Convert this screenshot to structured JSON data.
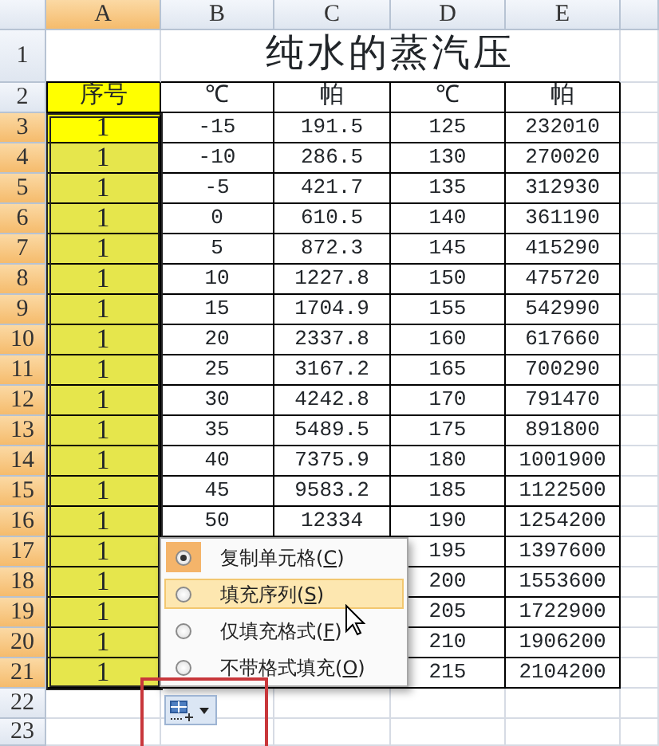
{
  "columns": [
    {
      "label": "A",
      "selected": true
    },
    {
      "label": "B",
      "selected": false
    },
    {
      "label": "C",
      "selected": false
    },
    {
      "label": "D",
      "selected": false
    },
    {
      "label": "E",
      "selected": false
    }
  ],
  "title": "纯水的蒸汽压",
  "header_row": {
    "number": "2",
    "cells": [
      "序号",
      "℃",
      "帕",
      "℃",
      "帕"
    ]
  },
  "title_row_number": "1",
  "rows": [
    {
      "number": "3",
      "selected": true,
      "active": true,
      "cells": [
        "1",
        "-15",
        "191.5",
        "125",
        "232010"
      ]
    },
    {
      "number": "4",
      "selected": true,
      "active": false,
      "cells": [
        "1",
        "-10",
        "286.5",
        "130",
        "270020"
      ]
    },
    {
      "number": "5",
      "selected": true,
      "active": false,
      "cells": [
        "1",
        "-5",
        "421.7",
        "135",
        "312930"
      ]
    },
    {
      "number": "6",
      "selected": true,
      "active": false,
      "cells": [
        "1",
        "0",
        "610.5",
        "140",
        "361190"
      ]
    },
    {
      "number": "7",
      "selected": true,
      "active": false,
      "cells": [
        "1",
        "5",
        "872.3",
        "145",
        "415290"
      ]
    },
    {
      "number": "8",
      "selected": true,
      "active": false,
      "cells": [
        "1",
        "10",
        "1227.8",
        "150",
        "475720"
      ]
    },
    {
      "number": "9",
      "selected": true,
      "active": false,
      "cells": [
        "1",
        "15",
        "1704.9",
        "155",
        "542990"
      ]
    },
    {
      "number": "10",
      "selected": true,
      "active": false,
      "cells": [
        "1",
        "20",
        "2337.8",
        "160",
        "617660"
      ]
    },
    {
      "number": "11",
      "selected": true,
      "active": false,
      "cells": [
        "1",
        "25",
        "3167.2",
        "165",
        "700290"
      ]
    },
    {
      "number": "12",
      "selected": true,
      "active": false,
      "cells": [
        "1",
        "30",
        "4242.8",
        "170",
        "791470"
      ]
    },
    {
      "number": "13",
      "selected": true,
      "active": false,
      "cells": [
        "1",
        "35",
        "5489.5",
        "175",
        "891800"
      ]
    },
    {
      "number": "14",
      "selected": true,
      "active": false,
      "cells": [
        "1",
        "40",
        "7375.9",
        "180",
        "1001900"
      ]
    },
    {
      "number": "15",
      "selected": true,
      "active": false,
      "cells": [
        "1",
        "45",
        "9583.2",
        "185",
        "1122500"
      ]
    },
    {
      "number": "16",
      "selected": true,
      "active": false,
      "cells": [
        "1",
        "50",
        "12334",
        "190",
        "1254200"
      ]
    },
    {
      "number": "17",
      "selected": true,
      "active": false,
      "cells": [
        "1",
        null,
        null,
        "195",
        "1397600"
      ]
    },
    {
      "number": "18",
      "selected": true,
      "active": false,
      "cells": [
        "1",
        null,
        null,
        "200",
        "1553600"
      ]
    },
    {
      "number": "19",
      "selected": true,
      "active": false,
      "cells": [
        "1",
        null,
        null,
        "205",
        "1722900"
      ]
    },
    {
      "number": "20",
      "selected": true,
      "active": false,
      "cells": [
        "1",
        null,
        null,
        "210",
        "1906200"
      ]
    },
    {
      "number": "21",
      "selected": true,
      "active": false,
      "cells": [
        "1",
        null,
        null,
        "215",
        "2104200"
      ]
    }
  ],
  "empty_rows": [
    "22",
    "23"
  ],
  "autofill_menu": {
    "options": [
      {
        "prefix": "复制单元格(",
        "key": "C",
        "suffix": ")",
        "checked": true,
        "hovered": false
      },
      {
        "prefix": "填充序列(",
        "key": "S",
        "suffix": ")",
        "checked": false,
        "hovered": true
      },
      {
        "prefix": "仅填充格式(",
        "key": "F",
        "suffix": ")",
        "checked": false,
        "hovered": false
      },
      {
        "prefix": "不带格式填充(",
        "key": "O",
        "suffix": ")",
        "checked": false,
        "hovered": false
      }
    ]
  },
  "autofill_button": {
    "marked": true
  }
}
